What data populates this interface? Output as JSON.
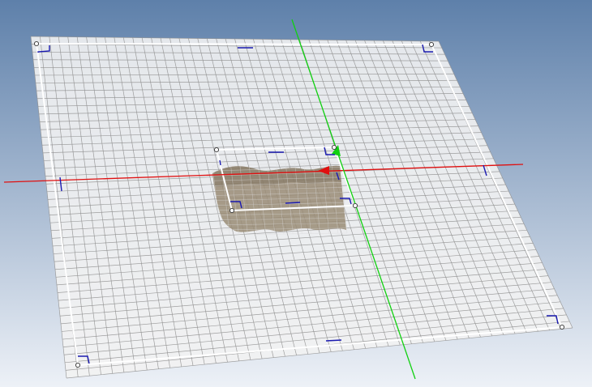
{
  "viewport": {
    "background_top": "#5e80aa",
    "background_bottom": "#edf1f7"
  },
  "colors": {
    "plane_fill": "#f2f2f2",
    "grid_line": "#8f8f8f",
    "boundary": "#ffffff",
    "handle": "#ffffff",
    "bracket": "#1a1ab0",
    "x_axis": "#e01010",
    "y_axis": "#10d010",
    "surface": "#9a8c75"
  },
  "scene": {
    "grid_divisions": 44,
    "outer_boundary": "rectangle-selection",
    "inner_boundary": "rectangle-selection",
    "surface": "wavy-terrain-patch"
  }
}
